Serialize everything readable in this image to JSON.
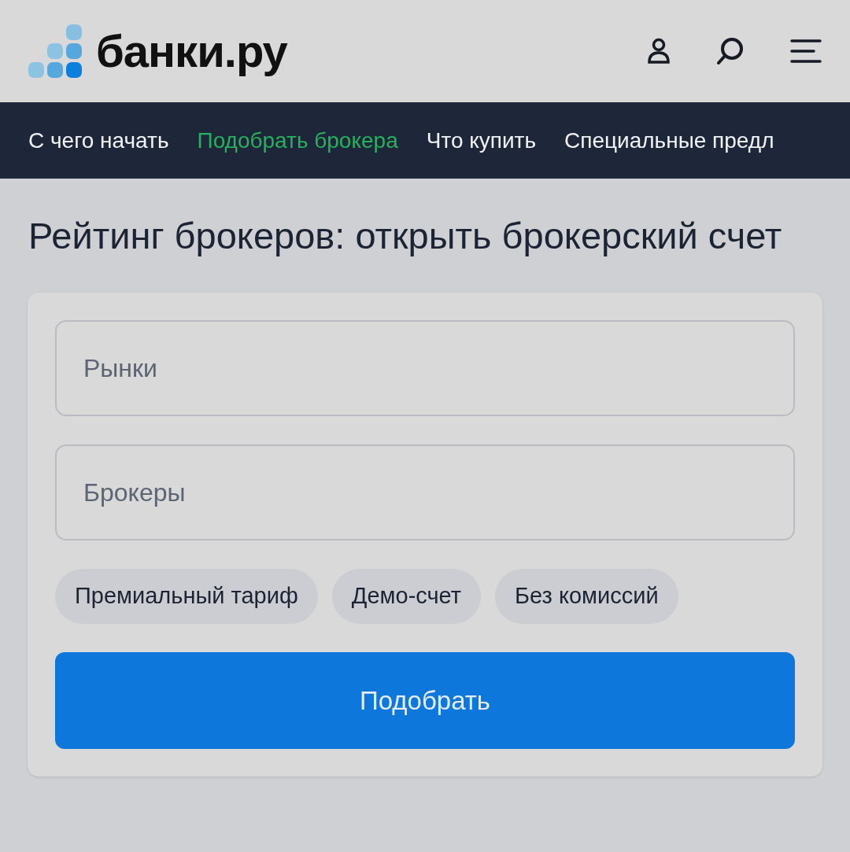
{
  "header": {
    "logo_text": "банки.ру"
  },
  "nav": [
    {
      "label": "С чего начать",
      "selected": false
    },
    {
      "label": "Подобрать брокера",
      "selected": true
    },
    {
      "label": "Что купить",
      "selected": false
    },
    {
      "label": "Специальные предл",
      "selected": false
    }
  ],
  "title": "Рейтинг брокеров: открыть брокерский счет",
  "filters": {
    "fields": [
      {
        "placeholder": "Рынки"
      },
      {
        "placeholder": "Брокеры"
      }
    ],
    "chips": [
      {
        "label": "Премиальный тариф"
      },
      {
        "label": "Демо-счет"
      },
      {
        "label": "Без комиссий"
      }
    ],
    "submit": "Подобрать"
  }
}
